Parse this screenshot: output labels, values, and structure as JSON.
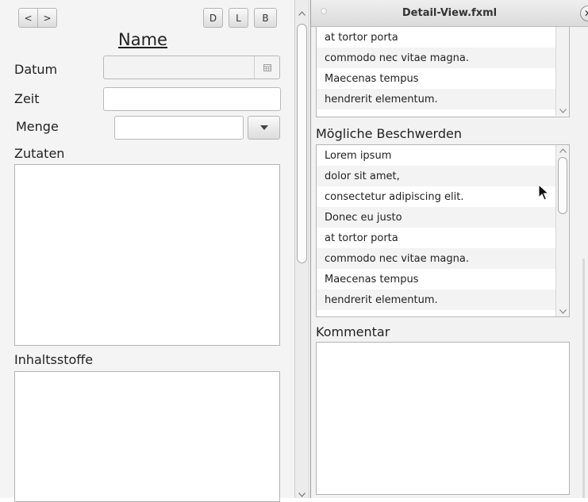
{
  "left": {
    "nav_prev": "<",
    "nav_next": ">",
    "btn_d": "D",
    "btn_l": "L",
    "btn_b": "B",
    "name_heading": "Name",
    "datum_label": "Datum",
    "zeit_label": "Zeit",
    "menge_label": "Menge",
    "zutaten_label": "Zutaten",
    "inhaltsstoffe_label": "Inhaltsstoffe",
    "datum_value": "",
    "zeit_value": "",
    "menge_value": ""
  },
  "window": {
    "title": "Detail-View.fxml",
    "top_list": [
      "at tortor porta",
      "commodo nec vitae magna.",
      "Maecenas tempus",
      "hendrerit elementum."
    ],
    "beschwerden_label": "Mögliche Beschwerden",
    "beschwerden_list": [
      "Lorem ipsum",
      "dolor sit amet,",
      "consectetur adipiscing elit.",
      "Donec eu justo",
      "at tortor porta",
      "commodo nec vitae magna.",
      "Maecenas tempus",
      "hendrerit elementum."
    ],
    "kommentar_label": "Kommentar",
    "kommentar_value": ""
  }
}
